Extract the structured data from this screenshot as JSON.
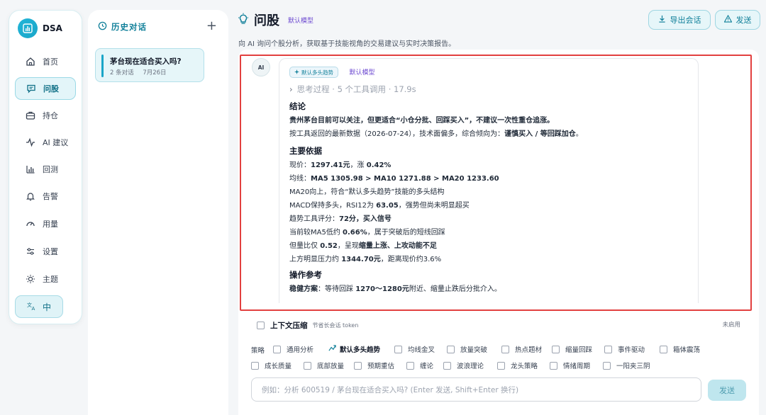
{
  "app": {
    "name": "DSA"
  },
  "sidebar": {
    "items": [
      {
        "label": "首页",
        "icon": "home-icon"
      },
      {
        "label": "问股",
        "icon": "chat-icon",
        "active": true
      },
      {
        "label": "持仓",
        "icon": "briefcase-icon"
      },
      {
        "label": "AI 建议",
        "icon": "pulse-icon"
      },
      {
        "label": "回测",
        "icon": "bar-chart-icon"
      },
      {
        "label": "告警",
        "icon": "bell-icon"
      },
      {
        "label": "用量",
        "icon": "gauge-icon"
      },
      {
        "label": "设置",
        "icon": "sliders-icon"
      },
      {
        "label": "主题",
        "icon": "sun-icon"
      }
    ],
    "language": "中"
  },
  "history": {
    "title": "历史对话",
    "items": [
      {
        "title": "茅台现在适合买入吗?",
        "count": "2 条对话",
        "date": "7月26日"
      }
    ]
  },
  "main": {
    "title": "问股",
    "model_tag": "默认模型",
    "subtitle": "向 AI 询问个股分析，获取基于技能视角的交易建议与实时决策报告。",
    "export_label": "导出会话",
    "send_top_label": "发送"
  },
  "message": {
    "avatar": "AI",
    "strategy_tag": "默认多头趋势",
    "model": "默认模型",
    "thinking": "思考过程 · 5 个工具调用 · 17.9s",
    "conclusion_title": "结论",
    "conclusion_1": "贵州茅台目前可以关注，但更适合“小仓分批、回踩买入”，不建议一次性重仓追涨。",
    "conclusion_2_pre": "按工具返回的最新数据（2026-07-24），技术面偏多，综合倾向为：",
    "conclusion_2_bold": "谨慎买入 / 等回踩加仓",
    "conclusion_2_post": "。",
    "basis_title": "主要依据",
    "price_pre": "现价：",
    "price_bold": "1297.41元",
    "price_mid": "，涨 ",
    "price_bold2": "0.42%",
    "ma_pre": "均线：",
    "ma_bold": "MA5 1305.98 > MA10 1271.88 > MA20 1233.60",
    "ma20_line": "MA20向上，符合“默认多头趋势”技能的多头结构",
    "macd_pre": "MACD保持多头，RSI12为 ",
    "macd_bold": "63.05",
    "macd_post": "，强势但尚未明显超买",
    "score_pre": "趋势工具评分：",
    "score_bold": "72分，买入信号",
    "ma5_pre": "当前较MA5低约 ",
    "ma5_bold": "0.66%",
    "ma5_post": "，属于突破后的短线回踩",
    "vol_pre": "但量比仅 ",
    "vol_bold": "0.52",
    "vol_mid": "，呈现",
    "vol_bold2": "缩量上涨、上攻动能不足",
    "resist_pre": "上方明显压力约 ",
    "resist_bold": "1344.70元",
    "resist_post": "，距离现价约3.6%",
    "ops_title": "操作参考",
    "plan_label": "稳健方案",
    "plan_pre": "：等待回踩 ",
    "plan_bold": "1270～1280元",
    "plan_post": "附近、缩量止跌后分批介入。"
  },
  "composer": {
    "ctx_label": "上下文压缩",
    "ctx_hint": "节省长会话 token",
    "ctx_status": "未启用",
    "strategy_label": "策略",
    "strategies": [
      "通用分析",
      "默认多头趋势",
      "均线金叉",
      "放量突破",
      "热点题材",
      "缩量回踩",
      "事件驱动",
      "箱体震荡",
      "成长质量",
      "底部放量",
      "预期重估",
      "缠论",
      "波浪理论",
      "龙头策略",
      "情绪周期",
      "一阳夹三阴"
    ],
    "placeholder": "例如：分析 600519 / 茅台现在适合买入吗? (Enter 发送, Shift+Enter 换行)",
    "send_label": "发送"
  },
  "colors": {
    "accent": "#1aa6c8",
    "highlight": "#e2403f",
    "model": "#6d4ad1"
  }
}
